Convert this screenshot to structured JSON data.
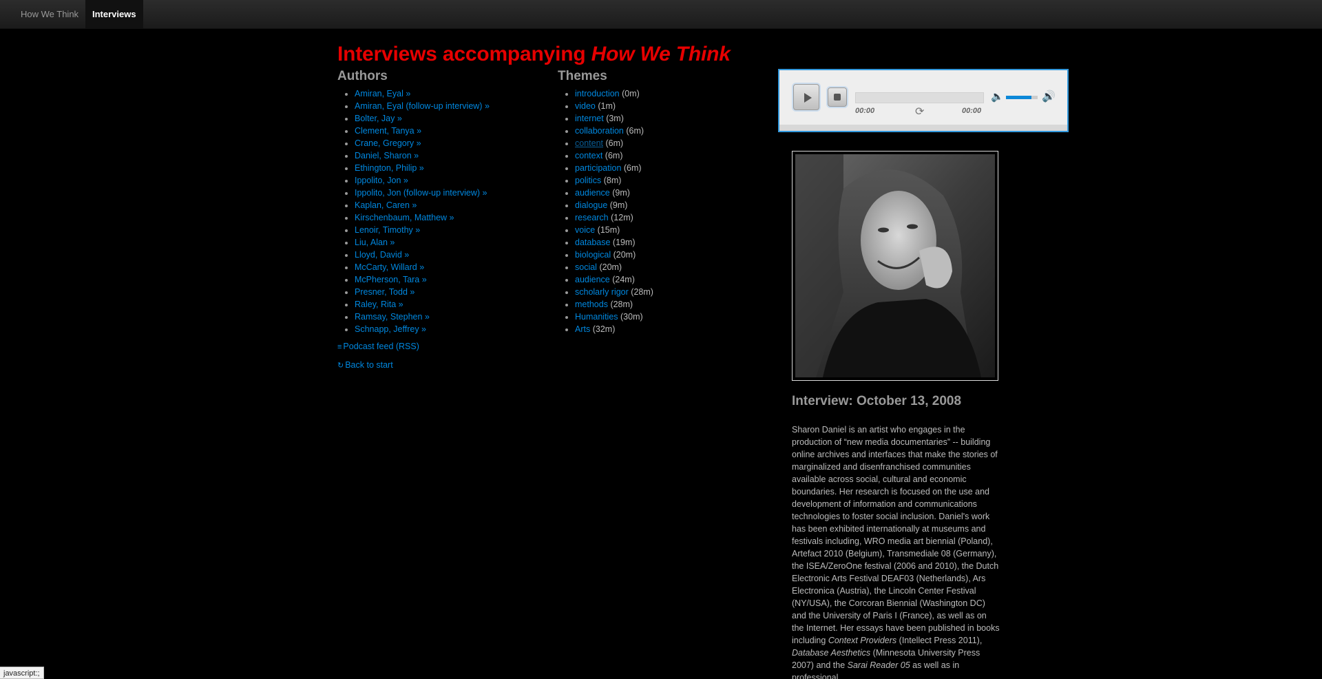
{
  "navbar": {
    "brand": "How We Think",
    "active_tab": "Interviews"
  },
  "page": {
    "title_prefix": "Interviews accompanying ",
    "title_book": "How We Think",
    "authors_heading": "Authors",
    "themes_heading": "Themes"
  },
  "authors": [
    "Amiran, Eyal »",
    "Amiran, Eyal (follow-up interview) »",
    "Bolter, Jay »",
    "Clement, Tanya »",
    "Crane, Gregory »",
    "Daniel, Sharon »",
    "Ethington, Philip »",
    "Ippolito, Jon »",
    "Ippolito, Jon (follow-up interview) »",
    "Kaplan, Caren »",
    "Kirschenbaum, Matthew »",
    "Lenoir, Timothy »",
    "Liu, Alan »",
    "Lloyd, David »",
    "McCarty, Willard »",
    "McPherson, Tara »",
    "Presner, Todd »",
    "Raley, Rita »",
    "Ramsay, Stephen »",
    "Schnapp, Jeffrey »"
  ],
  "themes": [
    {
      "label": "introduction",
      "time": "(0m)"
    },
    {
      "label": "video",
      "time": "(1m)"
    },
    {
      "label": "internet",
      "time": "(3m)"
    },
    {
      "label": "collaboration",
      "time": "(6m)"
    },
    {
      "label": "content",
      "time": "(6m)",
      "visited": true
    },
    {
      "label": "context",
      "time": "(6m)"
    },
    {
      "label": "participation",
      "time": "(6m)"
    },
    {
      "label": "politics",
      "time": "(8m)"
    },
    {
      "label": "audience",
      "time": "(9m)"
    },
    {
      "label": "dialogue",
      "time": "(9m)"
    },
    {
      "label": "research",
      "time": "(12m)"
    },
    {
      "label": "voice",
      "time": "(15m)"
    },
    {
      "label": "database",
      "time": "(19m)"
    },
    {
      "label": "biological",
      "time": "(20m)"
    },
    {
      "label": "social",
      "time": "(20m)"
    },
    {
      "label": "audience",
      "time": "(24m)"
    },
    {
      "label": "scholarly rigor",
      "time": "(28m)"
    },
    {
      "label": "methods",
      "time": "(28m)"
    },
    {
      "label": "Humanities",
      "time": "(30m)"
    },
    {
      "label": "Arts",
      "time": "(32m)"
    }
  ],
  "links": {
    "podcast": "Podcast feed (RSS)",
    "restart": "Back to start"
  },
  "player": {
    "current_time": "00:00",
    "duration": "00:00",
    "volume": 0.8,
    "icons": [
      "play-icon",
      "stop-icon",
      "repeat-icon",
      "mute-icon",
      "volume-max-icon"
    ]
  },
  "interview": {
    "title": "Interview: October 13, 2008",
    "bio_p1": "Sharon Daniel is an artist who engages in the production of “new media documentaries” -- building online archives and interfaces that make the stories of marginalized and disenfranchised communities available across social, cultural and economic boundaries. Her research is focused on the use and development of information and communications technologies to foster social inclusion. Daniel's work has been exhibited internationally at museums and festivals including, WRO media art biennial (Poland), Artefact 2010 (Belgium), Transmediale 08 (Germany), the ISEA/ZeroOne festival (2006 and 2010), the Dutch Electronic Arts Festival DEAF03 (Netherlands), Ars Electronica (Austria), the Lincoln Center Festival (NY/USA), the Corcoran Biennial (Washington DC) and the University of Paris I (France), as well as on the Internet. Her essays have been published in books including ",
    "book1": "Context Providers",
    "pub1": " (Intellect Press 2011), ",
    "book2": "Database Aesthetics",
    "pub2": " (Minnesota University Press 2007) and the ",
    "book3": "Sarai Reader 05",
    "tail": " as well as in professional"
  },
  "status_bar": "javascript:;",
  "colors": {
    "title": "#e60000",
    "link": "#0088e0",
    "background": "#000000",
    "player_border": "#3399dd"
  }
}
